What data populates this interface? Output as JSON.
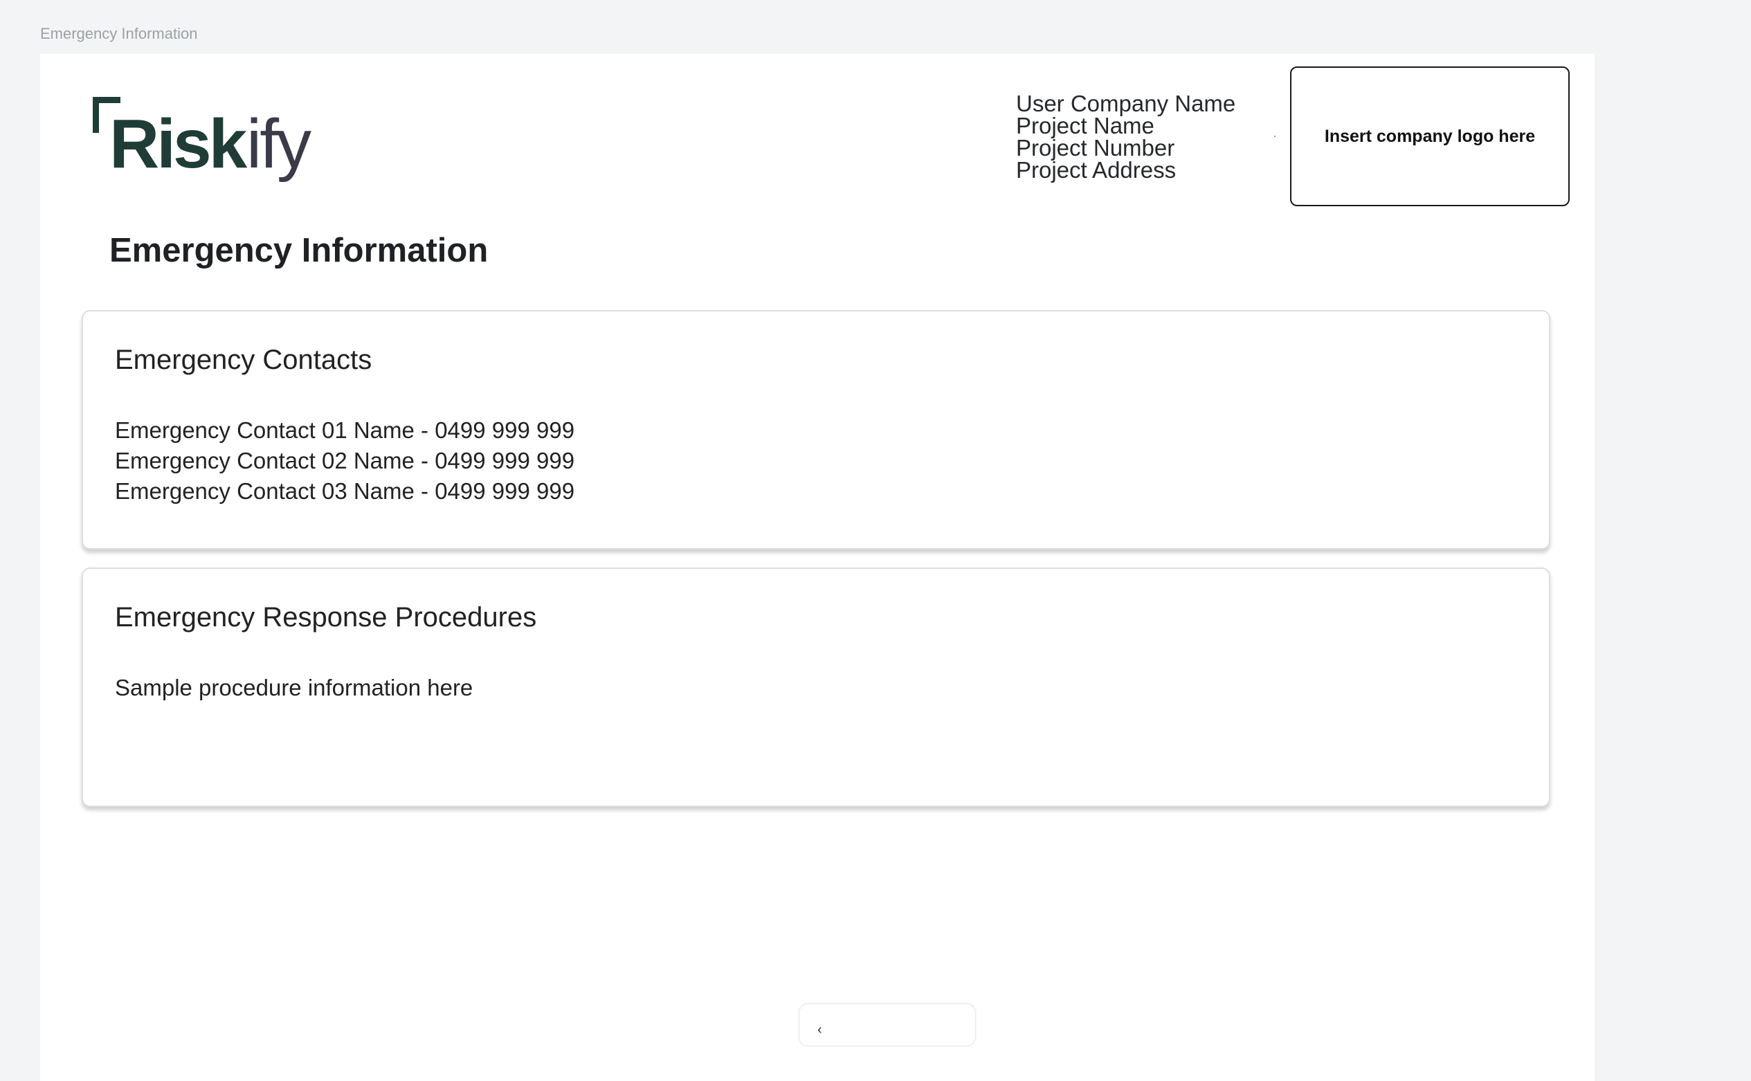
{
  "frame_label": "Emergency Information",
  "brand": {
    "logo_text": "Riskify",
    "colors": {
      "primary": "#1f3d36",
      "secondary": "#3a3a48"
    }
  },
  "header": {
    "company_name": "User Company Name",
    "project_name": "Project Name",
    "project_number": "Project Number",
    "project_address": "Project Address",
    "logo_placeholder": "Insert company logo here"
  },
  "page_title": "Emergency Information",
  "contacts": {
    "heading": "Emergency Contacts",
    "items": [
      "Emergency Contact 01 Name - 0499 999 999",
      "Emergency Contact 02 Name - 0499 999 999",
      "Emergency Contact 03 Name - 0499 999 999"
    ]
  },
  "procedures": {
    "heading": "Emergency Response Procedures",
    "body": "Sample procedure information here"
  },
  "bottom_tab": {
    "icon": "chevron-left-icon"
  }
}
